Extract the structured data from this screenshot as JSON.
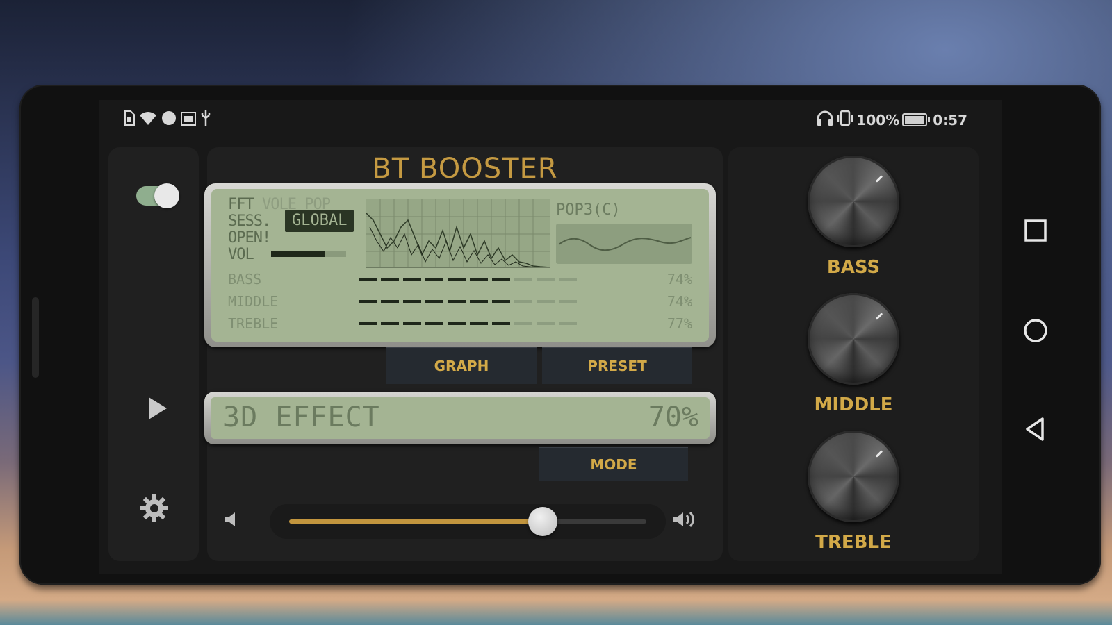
{
  "status_bar": {
    "left_icons": [
      "sim-card-icon",
      "wifi-icon",
      "record-icon",
      "calendar-icon",
      "usb-icon"
    ],
    "headphones_icon": "headphones-icon",
    "vibrate_icon": "vibrate-icon",
    "battery_percent": "100%",
    "battery_level": 1.0,
    "time": "0:57"
  },
  "sidebar": {
    "power_toggle_on": true,
    "play_icon": "play-icon",
    "settings_icon": "gear-icon"
  },
  "app": {
    "title": "BT BOOSTER"
  },
  "lcd": {
    "line1": "FFT",
    "line1_dim": "VOLE POP",
    "line2": "SESS.",
    "session": "GLOBAL",
    "line3": "OPEN!",
    "line4": "VOL",
    "volume_level": 0.72,
    "preset": "POP3(C)",
    "rows": [
      {
        "label": "BASS",
        "percent": "74%",
        "segments_on": 7,
        "segments_total": 10
      },
      {
        "label": "MIDDLE",
        "percent": "74%",
        "segments_on": 7,
        "segments_total": 10
      },
      {
        "label": "TREBLE",
        "percent": "77%",
        "segments_on": 7,
        "segments_total": 10
      }
    ]
  },
  "buttons": {
    "graph": "GRAPH",
    "preset": "PRESET",
    "mode": "MODE"
  },
  "effect": {
    "name": "3D EFFECT",
    "value": "70%"
  },
  "volume_slider": {
    "level": 0.71,
    "mute_icon": "volume-low-icon",
    "loud_icon": "volume-high-icon"
  },
  "knobs": [
    {
      "label": "BASS"
    },
    {
      "label": "MIDDLE"
    },
    {
      "label": "TREBLE"
    }
  ],
  "nav": {
    "recents_icon": "square-icon",
    "home_icon": "circle-icon",
    "back_icon": "triangle-back-icon"
  }
}
